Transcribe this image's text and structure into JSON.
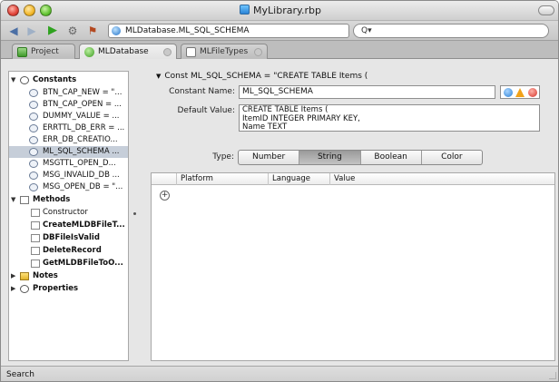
{
  "window": {
    "title": "MyLibrary.rbp"
  },
  "toolbar": {
    "location": "MLDatabase.ML_SQL_SCHEMA",
    "search_placeholder": "Q▾"
  },
  "tabs": [
    {
      "label": "Project"
    },
    {
      "label": "MLDatabase"
    },
    {
      "label": "MLFileTypes"
    }
  ],
  "sidebar": {
    "constants_label": "Constants",
    "constants": [
      "BTN_CAP_NEW = \"...",
      "BTN_CAP_OPEN = ...",
      "DUMMY_VALUE = ...",
      "ERRTTL_DB_ERR = ...",
      "ERR_DB_CREATIO...",
      "ML_SQL_SCHEMA ...",
      "MSGTTL_OPEN_D...",
      "MSG_INVALID_DB ...",
      "MSG_OPEN_DB = \"..."
    ],
    "selected_constant": "ML_SQL_SCHEMA ...",
    "methods_label": "Methods",
    "methods": [
      "Constructor",
      "CreateMLDBFileT...",
      "DBFileIsValid",
      "DeleteRecord",
      "GetMLDBFileToO..."
    ],
    "notes_label": "Notes",
    "properties_label": "Properties"
  },
  "editor": {
    "heading": "Const ML_SQL_SCHEMA = \"CREATE TABLE Items (",
    "name_label": "Constant Name:",
    "name_value": "ML_SQL_SCHEMA",
    "default_label": "Default Value:",
    "default_value": "CREATE TABLE Items (\nItemID INTEGER PRIMARY KEY,\nName TEXT",
    "type_label": "Type:",
    "types": [
      "Number",
      "String",
      "Boolean",
      "Color"
    ],
    "selected_type": "String"
  },
  "grid": {
    "columns": [
      "Platform",
      "Language",
      "Value"
    ],
    "add_symbol": "+"
  },
  "statusbar": {
    "text": "Search"
  }
}
